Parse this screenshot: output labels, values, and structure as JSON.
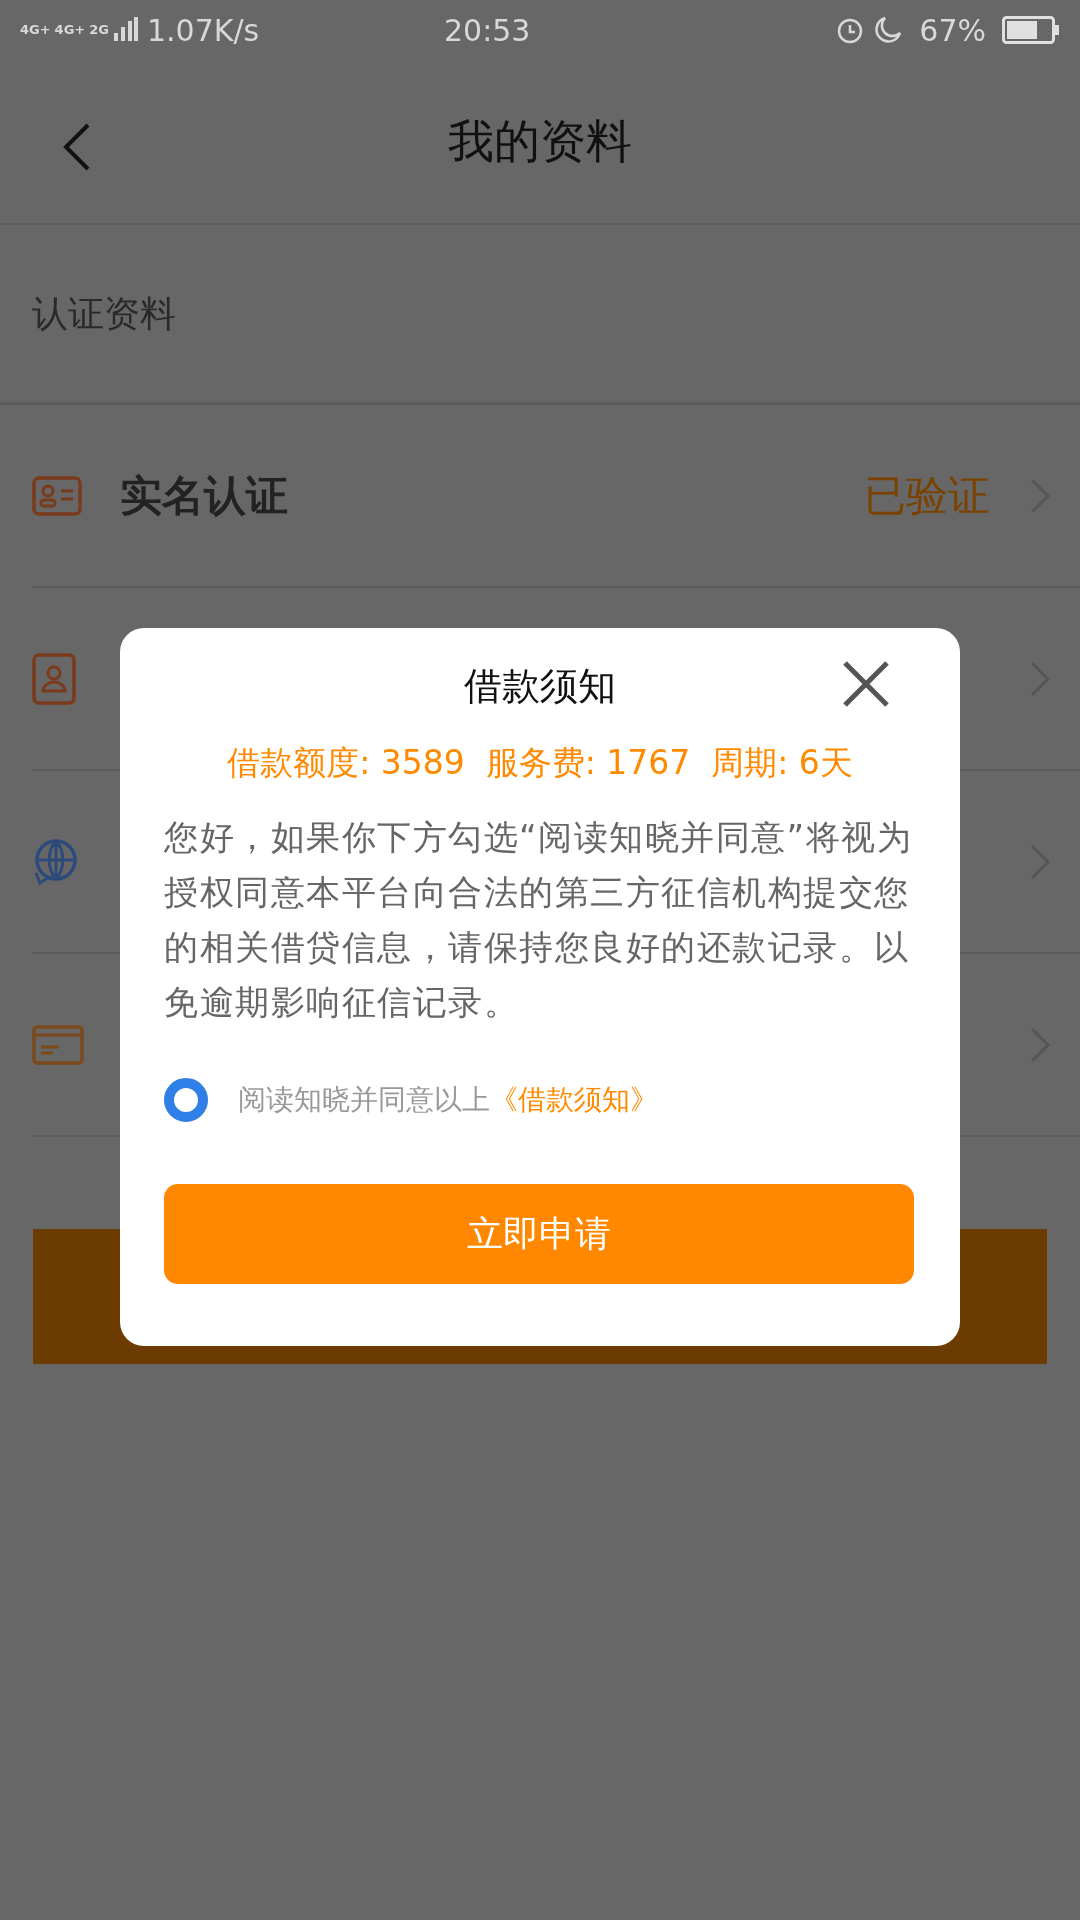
{
  "status_bar": {
    "network_labels": [
      "4G+",
      "4G+",
      "2G"
    ],
    "speed": "1.07K/s",
    "time": "20:53",
    "battery": "67%"
  },
  "header": {
    "title": "我的资料"
  },
  "section_label": "认证资料",
  "rows": [
    {
      "kind": "id-card",
      "label": "实名认证",
      "status": "已验证"
    },
    {
      "kind": "contact-book"
    },
    {
      "kind": "globe"
    },
    {
      "kind": "card"
    }
  ],
  "dialog": {
    "title": "借款须知",
    "summary": "借款额度: 3589  服务费: 1767  周期: 6天",
    "body": "您好，如果你下方勾选“阅读知晓并同意”将视为授权同意本平台向合法的第三方征信机构提交您的相关借贷信息，请保持您良好的还款记录。以免逾期影响征信记录。",
    "agreement": {
      "checked": true,
      "text": "阅读知晓并同意以上",
      "link": "《借款须知》"
    },
    "button": "立即申请"
  }
}
